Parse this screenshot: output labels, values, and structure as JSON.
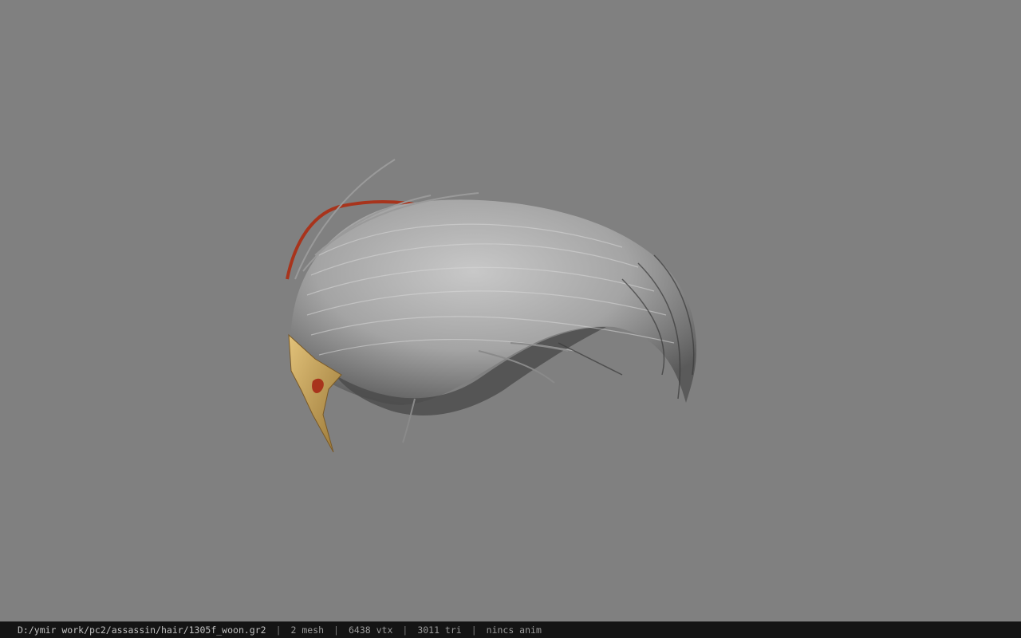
{
  "window": {
    "background_color": "#808080"
  },
  "viewport": {
    "model": "hair-mesh",
    "hair_color": "#b4b4b4",
    "accent_color": "#a8341c",
    "ornament_color": "#c8a050"
  },
  "statusbar": {
    "file_path": "D:/ymir work/pc2/assassin/hair/1305f_woon.gr2",
    "separator": "|",
    "mesh_count": "2 mesh",
    "vertex_count": "6438 vtx",
    "triangle_count": "3011 tri",
    "animation": "nincs anim"
  }
}
